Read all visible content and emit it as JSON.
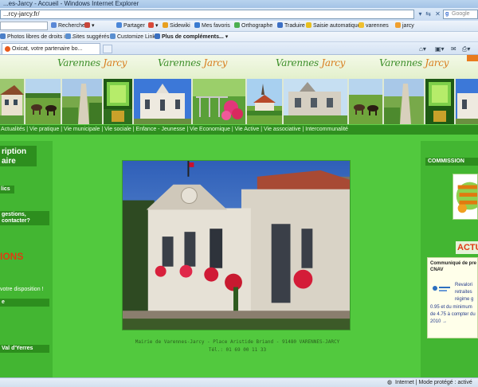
{
  "browser": {
    "title": "...es-Jarcy - Accueil - Windows Internet Explorer",
    "url": "...rcy-jarcy.fr/",
    "search_placeholder": "Google",
    "toolbar": {
      "search": "Rechercher",
      "share": "Partager",
      "sidewiki": "Sidewiki",
      "favorites": "Mes favoris",
      "spelling": "Orthographe",
      "translate": "Traduire",
      "autofill": "Saisie automatique",
      "term1": "varennes",
      "term2": "jarcy"
    },
    "favorites": [
      "Photos libres de droits im...",
      "Sites suggérés",
      "Customize Links",
      "Plus de compléments..."
    ],
    "tab_label": "Oxicat, votre partenaire bo...",
    "status": "Internet | Mode protégé : activé"
  },
  "site": {
    "logo_main": "Varennes",
    "logo_accent": "Jarcy",
    "nav": "Actualités | Vie pratique | Vie municipale | Vie sociale | Enfance - Jeunesse | Vie Economique | Vie Active | Vie associative | Intercommunalité",
    "left": {
      "box1_line1": "ription",
      "box1_line2": "aire",
      "tag": "lics",
      "q1": "gestions,",
      "q2": "contacter?",
      "brand": "IONS",
      "disposal": "votre disposition !",
      "small_box": "e",
      "val": "Val d'Yerres"
    },
    "caption_line1": "Mairie de Varennes-Jarcy - Place Aristide Briand - 91480 VARENNES-JARCY",
    "caption_line2": "Tél.: 01 69 00 11 33",
    "right": {
      "commission": "COMMISSION",
      "actu": "ACTU",
      "news_title1": "Communiqué de pre",
      "news_title2": "CNAV",
      "news_lines": [
        "Revalori",
        "retraites",
        "régime g",
        "0.95 et du minimum",
        "de 4.75 à compter du",
        "2010 →"
      ]
    }
  }
}
